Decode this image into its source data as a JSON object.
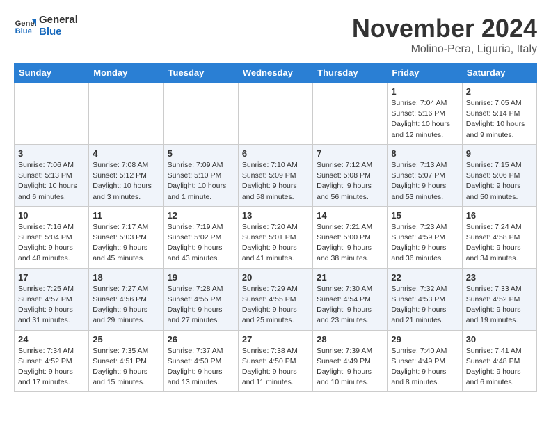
{
  "header": {
    "logo_general": "General",
    "logo_blue": "Blue",
    "month_title": "November 2024",
    "location": "Molino-Pera, Liguria, Italy"
  },
  "days_of_week": [
    "Sunday",
    "Monday",
    "Tuesday",
    "Wednesday",
    "Thursday",
    "Friday",
    "Saturday"
  ],
  "weeks": [
    [
      {
        "day": "",
        "info": ""
      },
      {
        "day": "",
        "info": ""
      },
      {
        "day": "",
        "info": ""
      },
      {
        "day": "",
        "info": ""
      },
      {
        "day": "",
        "info": ""
      },
      {
        "day": "1",
        "info": "Sunrise: 7:04 AM\nSunset: 5:16 PM\nDaylight: 10 hours and 12 minutes."
      },
      {
        "day": "2",
        "info": "Sunrise: 7:05 AM\nSunset: 5:14 PM\nDaylight: 10 hours and 9 minutes."
      }
    ],
    [
      {
        "day": "3",
        "info": "Sunrise: 7:06 AM\nSunset: 5:13 PM\nDaylight: 10 hours and 6 minutes."
      },
      {
        "day": "4",
        "info": "Sunrise: 7:08 AM\nSunset: 5:12 PM\nDaylight: 10 hours and 3 minutes."
      },
      {
        "day": "5",
        "info": "Sunrise: 7:09 AM\nSunset: 5:10 PM\nDaylight: 10 hours and 1 minute."
      },
      {
        "day": "6",
        "info": "Sunrise: 7:10 AM\nSunset: 5:09 PM\nDaylight: 9 hours and 58 minutes."
      },
      {
        "day": "7",
        "info": "Sunrise: 7:12 AM\nSunset: 5:08 PM\nDaylight: 9 hours and 56 minutes."
      },
      {
        "day": "8",
        "info": "Sunrise: 7:13 AM\nSunset: 5:07 PM\nDaylight: 9 hours and 53 minutes."
      },
      {
        "day": "9",
        "info": "Sunrise: 7:15 AM\nSunset: 5:06 PM\nDaylight: 9 hours and 50 minutes."
      }
    ],
    [
      {
        "day": "10",
        "info": "Sunrise: 7:16 AM\nSunset: 5:04 PM\nDaylight: 9 hours and 48 minutes."
      },
      {
        "day": "11",
        "info": "Sunrise: 7:17 AM\nSunset: 5:03 PM\nDaylight: 9 hours and 45 minutes."
      },
      {
        "day": "12",
        "info": "Sunrise: 7:19 AM\nSunset: 5:02 PM\nDaylight: 9 hours and 43 minutes."
      },
      {
        "day": "13",
        "info": "Sunrise: 7:20 AM\nSunset: 5:01 PM\nDaylight: 9 hours and 41 minutes."
      },
      {
        "day": "14",
        "info": "Sunrise: 7:21 AM\nSunset: 5:00 PM\nDaylight: 9 hours and 38 minutes."
      },
      {
        "day": "15",
        "info": "Sunrise: 7:23 AM\nSunset: 4:59 PM\nDaylight: 9 hours and 36 minutes."
      },
      {
        "day": "16",
        "info": "Sunrise: 7:24 AM\nSunset: 4:58 PM\nDaylight: 9 hours and 34 minutes."
      }
    ],
    [
      {
        "day": "17",
        "info": "Sunrise: 7:25 AM\nSunset: 4:57 PM\nDaylight: 9 hours and 31 minutes."
      },
      {
        "day": "18",
        "info": "Sunrise: 7:27 AM\nSunset: 4:56 PM\nDaylight: 9 hours and 29 minutes."
      },
      {
        "day": "19",
        "info": "Sunrise: 7:28 AM\nSunset: 4:55 PM\nDaylight: 9 hours and 27 minutes."
      },
      {
        "day": "20",
        "info": "Sunrise: 7:29 AM\nSunset: 4:55 PM\nDaylight: 9 hours and 25 minutes."
      },
      {
        "day": "21",
        "info": "Sunrise: 7:30 AM\nSunset: 4:54 PM\nDaylight: 9 hours and 23 minutes."
      },
      {
        "day": "22",
        "info": "Sunrise: 7:32 AM\nSunset: 4:53 PM\nDaylight: 9 hours and 21 minutes."
      },
      {
        "day": "23",
        "info": "Sunrise: 7:33 AM\nSunset: 4:52 PM\nDaylight: 9 hours and 19 minutes."
      }
    ],
    [
      {
        "day": "24",
        "info": "Sunrise: 7:34 AM\nSunset: 4:52 PM\nDaylight: 9 hours and 17 minutes."
      },
      {
        "day": "25",
        "info": "Sunrise: 7:35 AM\nSunset: 4:51 PM\nDaylight: 9 hours and 15 minutes."
      },
      {
        "day": "26",
        "info": "Sunrise: 7:37 AM\nSunset: 4:50 PM\nDaylight: 9 hours and 13 minutes."
      },
      {
        "day": "27",
        "info": "Sunrise: 7:38 AM\nSunset: 4:50 PM\nDaylight: 9 hours and 11 minutes."
      },
      {
        "day": "28",
        "info": "Sunrise: 7:39 AM\nSunset: 4:49 PM\nDaylight: 9 hours and 10 minutes."
      },
      {
        "day": "29",
        "info": "Sunrise: 7:40 AM\nSunset: 4:49 PM\nDaylight: 9 hours and 8 minutes."
      },
      {
        "day": "30",
        "info": "Sunrise: 7:41 AM\nSunset: 4:48 PM\nDaylight: 9 hours and 6 minutes."
      }
    ]
  ]
}
